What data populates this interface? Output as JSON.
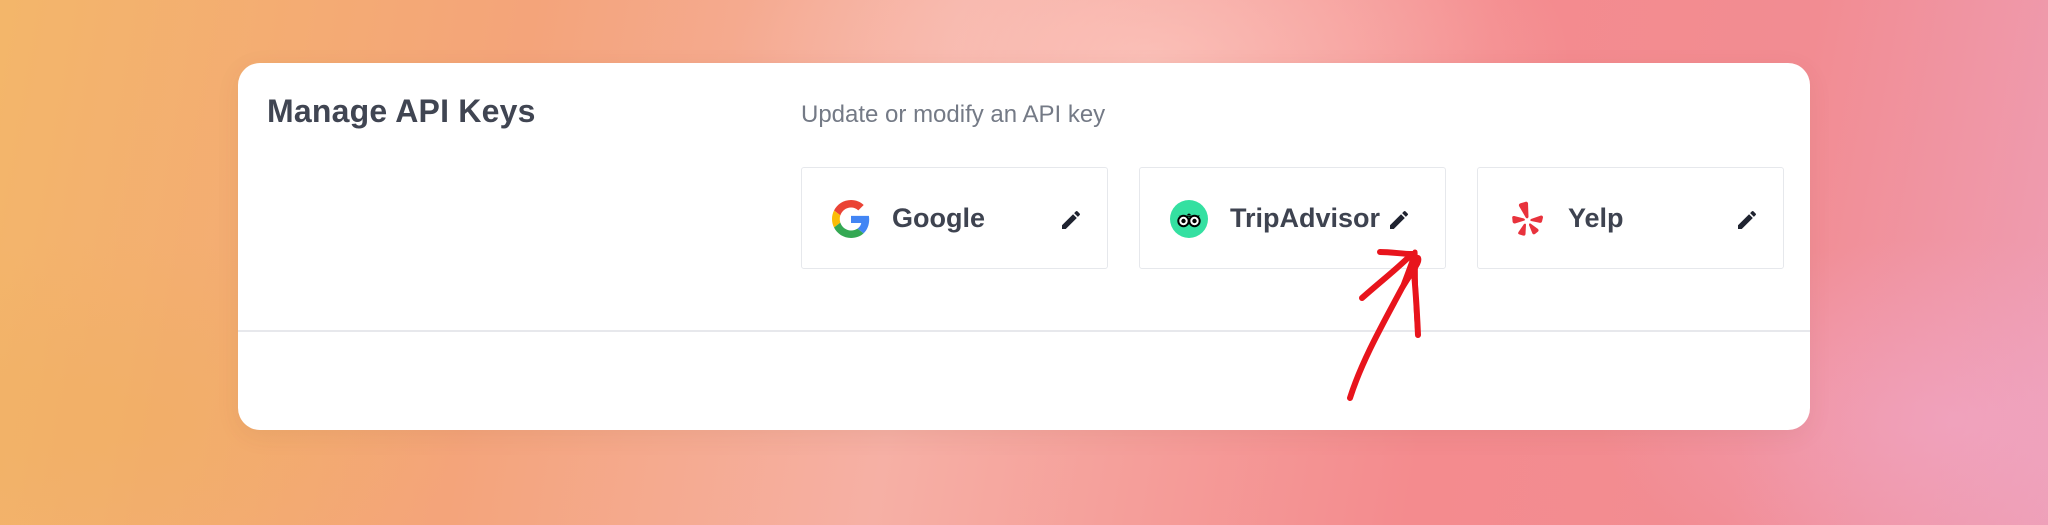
{
  "section": {
    "title": "Manage API Keys",
    "subtitle": "Update or modify an API key"
  },
  "providers": [
    {
      "name": "Google",
      "logo_icon": "google-logo-icon",
      "action_icon": "pencil-icon"
    },
    {
      "name": "TripAdvisor",
      "logo_icon": "tripadvisor-logo-icon",
      "action_icon": "pencil-icon"
    },
    {
      "name": "Yelp",
      "logo_icon": "yelp-logo-icon",
      "action_icon": "pencil-icon"
    }
  ],
  "colors": {
    "tripadvisor_green": "#34e0a1",
    "yelp_red": "#e8323c",
    "annotation_red": "#e8141c",
    "text_dark": "#3e4350",
    "text_muted": "#747a86"
  }
}
